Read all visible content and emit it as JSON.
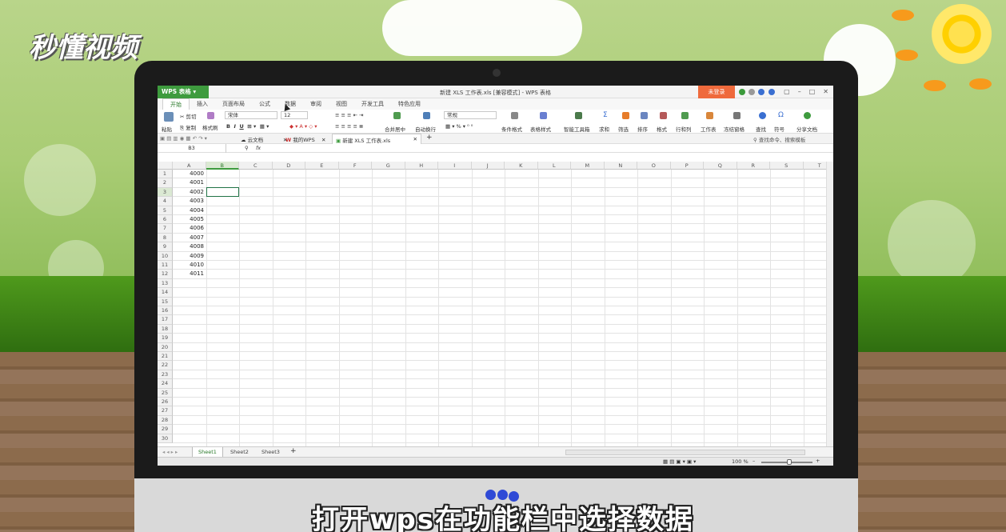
{
  "logo": {
    "text": "秒懂视频"
  },
  "app": {
    "app_button": "WPS 表格",
    "window_title": "新建 XLS 工作表.xls [兼容模式] - WPS 表格",
    "login_label": "未登录"
  },
  "ribbon": {
    "tabs": [
      "开始",
      "插入",
      "页面布局",
      "公式",
      "数据",
      "审阅",
      "视图",
      "开发工具",
      "特色应用"
    ],
    "clipboard": {
      "cut": "剪切",
      "copy": "复制",
      "format_painter": "格式刷",
      "paste": "粘贴"
    },
    "font_name": "宋体",
    "font_size": "12",
    "format_select": "常规",
    "merge": "合并居中",
    "wrap": "自动换行",
    "conditional_format": "条件格式",
    "table_style": "表格样式",
    "smart_toolbox": "智能工具箱",
    "sum": "求和",
    "filter": "筛选",
    "sort": "排序",
    "format": "格式",
    "rows_cols": "行和列",
    "worksheet": "工作表",
    "freeze": "冻结窗格",
    "find": "查找",
    "symbol": "符号",
    "share": "分享文档"
  },
  "quickbar": {
    "tabs": [
      "云文档",
      "我的WPS",
      "新建 XLS 工作表.xls"
    ],
    "search_placeholder": "查找命令、搜索模板"
  },
  "formula": {
    "name_box": "B3",
    "fx": "fx"
  },
  "grid": {
    "columns": [
      "A",
      "B",
      "C",
      "D",
      "E",
      "F",
      "G",
      "H",
      "I",
      "J",
      "K",
      "L",
      "M",
      "N",
      "O",
      "P",
      "Q",
      "R",
      "S",
      "T"
    ],
    "rows": [
      "1",
      "2",
      "3",
      "4",
      "5",
      "6",
      "7",
      "8",
      "9",
      "10",
      "11",
      "12",
      "13",
      "14",
      "15",
      "16",
      "17",
      "18",
      "19",
      "20",
      "21",
      "22",
      "23",
      "24",
      "25",
      "26",
      "27",
      "28",
      "29",
      "30"
    ],
    "column_a_values": [
      "4000",
      "4001",
      "4002",
      "4003",
      "4004",
      "4005",
      "4006",
      "4007",
      "4008",
      "4009",
      "4010",
      "4011"
    ],
    "active_cell": "B3"
  },
  "sheets": [
    "Sheet1",
    "Sheet2",
    "Sheet3"
  ],
  "status": {
    "zoom": "100 %"
  },
  "subtitle": "打开wps在功能栏中选择数据"
}
